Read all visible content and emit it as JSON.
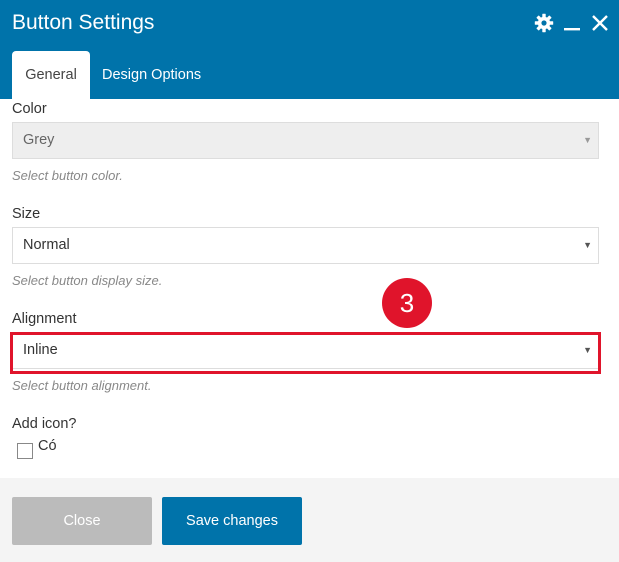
{
  "dialog": {
    "title": "Button Settings"
  },
  "header_icons": [
    "gear-icon",
    "minimize-icon",
    "close-icon"
  ],
  "tabs": [
    {
      "label": "General",
      "active": true
    },
    {
      "label": "Design Options",
      "active": false
    }
  ],
  "fields": {
    "color": {
      "label": "Color",
      "value": "Grey",
      "help": "Select button color.",
      "disabled": true
    },
    "size": {
      "label": "Size",
      "value": "Normal",
      "help": "Select button display size."
    },
    "alignment": {
      "label": "Alignment",
      "value": "Inline",
      "help": "Select button alignment."
    },
    "add_icon": {
      "label": "Add icon?",
      "option": "Có",
      "checked": false
    }
  },
  "annotation": {
    "step": "3"
  },
  "footer": {
    "close_label": "Close",
    "save_label": "Save changes"
  },
  "colors": {
    "header": "#0073aa",
    "highlight": "#e0142b",
    "save_button": "#0073aa",
    "close_button": "#bbbbbb"
  }
}
